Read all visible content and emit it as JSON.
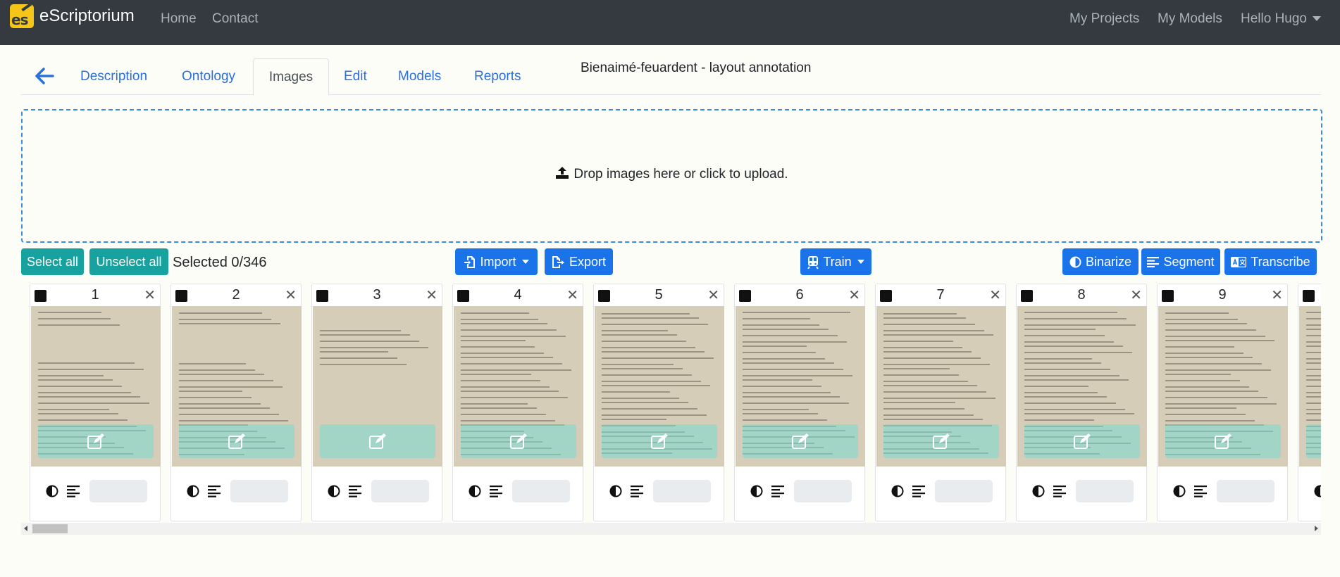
{
  "app": {
    "brand": "eScriptorium",
    "brand_logo_text": "es",
    "nav": [
      "Home",
      "Contact"
    ],
    "right_nav": [
      "My Projects",
      "My Models"
    ],
    "user_menu": "Hello Hugo"
  },
  "tabs": [
    {
      "label": "Description",
      "active": false
    },
    {
      "label": "Ontology",
      "active": false
    },
    {
      "label": "Images",
      "active": true
    },
    {
      "label": "Edit",
      "active": false
    },
    {
      "label": "Models",
      "active": false
    },
    {
      "label": "Reports",
      "active": false
    }
  ],
  "document_title": "Bienaimé-feuardent - layout annotation",
  "dropzone": {
    "text": "Drop images here or click to upload."
  },
  "toolbar": {
    "select_all": "Select all",
    "unselect_all": "Unselect all",
    "selected": "Selected 0/346",
    "import": "Import",
    "export": "Export",
    "train": "Train",
    "binarize": "Binarize",
    "segment": "Segment",
    "transcribe": "Transcribe"
  },
  "colors": {
    "navbar": "#343a40",
    "primary": "#1a73e8",
    "teal": "#17a2a0",
    "link": "#2a6fdb"
  },
  "cards": [
    {
      "number": "1",
      "close": "✕"
    },
    {
      "number": "2",
      "close": "✕"
    },
    {
      "number": "3",
      "close": "✕"
    },
    {
      "number": "4",
      "close": "✕"
    },
    {
      "number": "5",
      "close": "✕"
    },
    {
      "number": "6",
      "close": "✕"
    },
    {
      "number": "7",
      "close": "✕"
    },
    {
      "number": "8",
      "close": "✕"
    },
    {
      "number": "9",
      "close": "✕"
    }
  ],
  "icons": {
    "back": "arrow-left-icon",
    "upload": "upload-icon",
    "import": "file-import-icon",
    "export": "file-export-icon",
    "train": "train-icon",
    "binarize": "contrast-icon",
    "segment": "align-left-icon",
    "transcribe": "language-icon",
    "edit": "edit-icon"
  }
}
